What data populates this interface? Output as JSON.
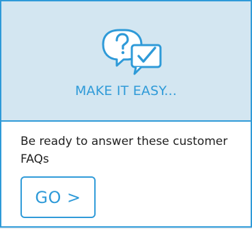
{
  "card": {
    "banner": {
      "icon": "faq-question-check-icon",
      "title": "MAKE IT EASY..."
    },
    "body_text": "Be ready to answer these customer FAQs",
    "go_button_label": "GO >"
  },
  "colors": {
    "accent": "#2e9ad8",
    "banner_bg": "#d3e6f1",
    "text": "#1f1f1f",
    "background": "#ffffff"
  }
}
